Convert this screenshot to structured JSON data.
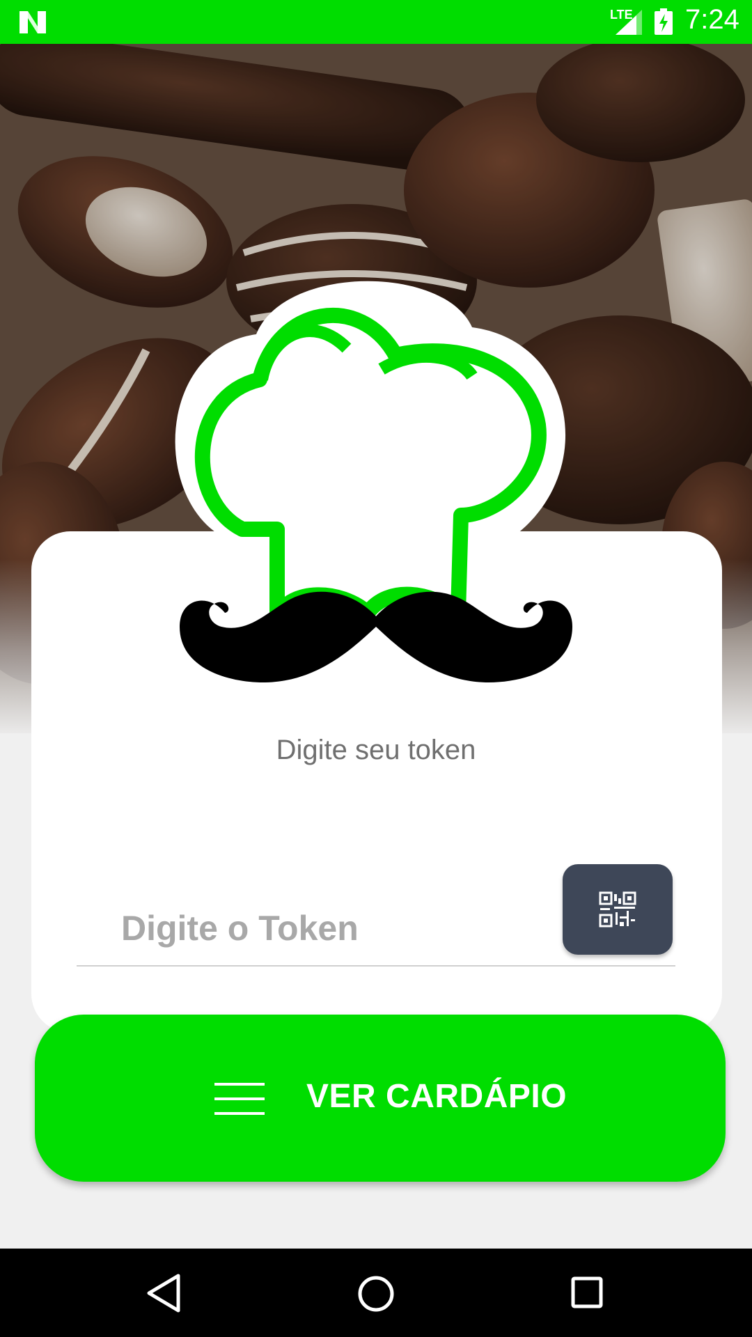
{
  "status_bar": {
    "time": "7:24",
    "network_label": "LTE",
    "icons": [
      "notification-n-icon",
      "signal-icon",
      "battery-charging-icon"
    ]
  },
  "colors": {
    "accent": "#00dd00",
    "qr_button": "#3e4758",
    "background": "#f0f0f0"
  },
  "hero": {
    "image": "chocolate-candies-background"
  },
  "logo": {
    "icon": "chef-hat-mustache-logo"
  },
  "form": {
    "subtitle": "Digite seu token",
    "token_placeholder": "Digite o Token",
    "token_value": "",
    "qr_icon": "qr-code-icon"
  },
  "action": {
    "label": "VER CARDÁPIO",
    "icon": "menu-lines-icon"
  },
  "nav_bar": {
    "icons": [
      "back-icon",
      "home-icon",
      "recents-icon"
    ]
  }
}
